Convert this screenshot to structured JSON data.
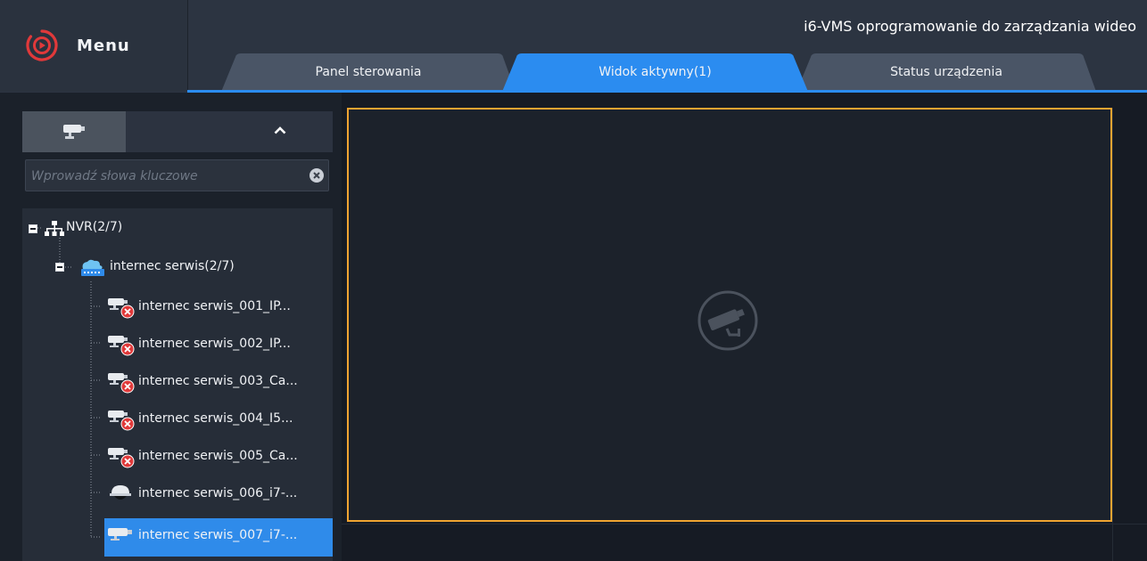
{
  "header": {
    "menu_label": "Menu",
    "app_title": "i6-VMS oprogramowanie do zarządzania wideo",
    "tabs": [
      {
        "label": "Panel sterowania",
        "active": false
      },
      {
        "label": "Widok aktywny(1)",
        "active": true
      },
      {
        "label": "Status urządzenia",
        "active": false
      }
    ]
  },
  "sidebar": {
    "search_placeholder": "Wprowadź słowa kluczowe",
    "tree": {
      "root": {
        "label": "NVR(2/7)",
        "icon": "network-icon"
      },
      "group": {
        "label": "internec serwis(2/7)",
        "icon": "nvr-device-icon"
      },
      "devices": [
        {
          "label": "internec serwis_001_IP...",
          "status": "offline"
        },
        {
          "label": "internec serwis_002_IP...",
          "status": "offline"
        },
        {
          "label": "internec serwis_003_Ca...",
          "status": "offline"
        },
        {
          "label": "internec serwis_004_I5...",
          "status": "offline"
        },
        {
          "label": "internec serwis_005_Ca...",
          "status": "offline"
        },
        {
          "label": "internec serwis_006_i7-...",
          "status": "online"
        },
        {
          "label": "internec serwis_007_i7-...",
          "status": "online",
          "selected": true
        }
      ]
    }
  },
  "colors": {
    "accent": "#2b8cf0",
    "selection": "#2f8bea",
    "active_cell_border": "#f0a431",
    "offline_badge": "#e0393a"
  }
}
